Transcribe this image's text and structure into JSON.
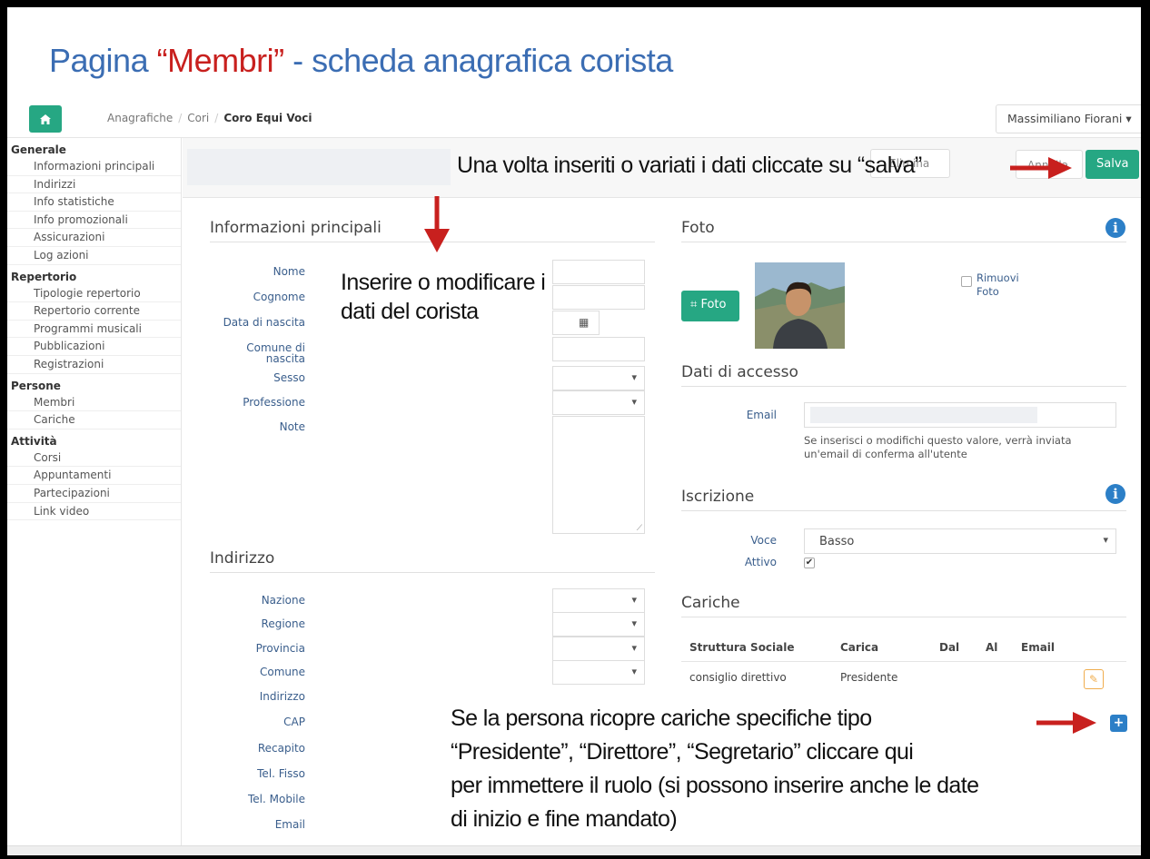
{
  "slide": {
    "title_part1": "Pagina ",
    "title_highlight": "“Membri”",
    "title_part2": " - scheda anagrafica corista"
  },
  "colors": {
    "accent": "#26a783",
    "title_blue": "#3b6db3",
    "highlight_red": "#c8201e",
    "info_blue": "#2c7fc7"
  },
  "nav": {
    "home_icon": "home-icon",
    "breadcrumb": [
      "Anagrafiche",
      "Cori",
      "Coro Equi Voci"
    ],
    "user": "Massimiliano Fiorani"
  },
  "sidebar": {
    "groups": [
      {
        "title": "Generale",
        "items": [
          "Informazioni principali",
          "Indirizzi",
          "Info statistiche",
          "Info promozionali",
          "Assicurazioni",
          "Log azioni"
        ]
      },
      {
        "title": "Repertorio",
        "items": [
          "Tipologie repertorio",
          "Repertorio corrente",
          "Programmi musicali",
          "Pubblicazioni",
          "Registrazioni"
        ]
      },
      {
        "title": "Persone",
        "items": [
          "Membri",
          "Cariche"
        ]
      },
      {
        "title": "Attività",
        "items": [
          "Corsi",
          "Appuntamenti",
          "Partecipazioni",
          "Link video"
        ]
      }
    ]
  },
  "toolbar": {
    "hidden_label": "Elimina",
    "annulla": "Annulla",
    "salva": "Salva"
  },
  "info": {
    "title": "Informazioni principali",
    "fields": [
      "Nome",
      "Cognome",
      "Data di nascita",
      "Comune di nascita",
      "Sesso",
      "Professione",
      "Note"
    ]
  },
  "address": {
    "title": "Indirizzo",
    "fields": [
      "Nazione",
      "Regione",
      "Provincia",
      "Comune",
      "Indirizzo",
      "CAP",
      "Recapito",
      "Tel. Fisso",
      "Tel. Mobile",
      "Email"
    ]
  },
  "foto": {
    "title": "Foto",
    "button": "Foto",
    "remove": "Rimuovi Foto"
  },
  "access": {
    "title": "Dati di accesso",
    "email_label": "Email",
    "hint": "Se inserisci o modifichi questo valore, verrà inviata un'email di conferma all'utente"
  },
  "iscrizione": {
    "title": "Iscrizione",
    "voce_label": "Voce",
    "voce_value": "Basso",
    "attivo_label": "Attivo"
  },
  "cariche": {
    "title": "Cariche",
    "columns": [
      "Struttura Sociale",
      "Carica",
      "Dal",
      "Al",
      "Email"
    ],
    "rows": [
      {
        "struttura": "consiglio direttivo",
        "carica": "Presidente"
      }
    ]
  },
  "annotations": {
    "save": "Una volta inseriti o variati i dati  cliccate su “salva”",
    "edit": [
      "Inserire o modificare i",
      "dati del corista"
    ],
    "roles": [
      "Se la persona ricopre cariche specifiche tipo",
      "“Presidente”, “Direttore”, “Segretario” cliccare qui",
      "per immettere il ruolo  (si possono inserire anche le date",
      "di inizio e fine mandato)"
    ]
  }
}
